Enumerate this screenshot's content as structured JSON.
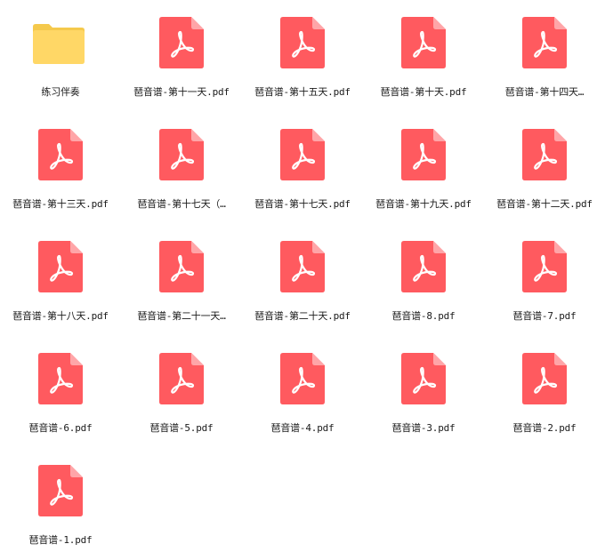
{
  "window": {
    "view": "file-grid"
  },
  "colors": {
    "pdf_red": "#FF5A5F",
    "pdf_fold": "#FFA5A8",
    "folder_yellow": "#FFD766",
    "folder_tab": "#F5C94C",
    "label_text": "#1a1a1a"
  },
  "items": [
    {
      "type": "folder",
      "icon": "folder-icon",
      "label": "练习伴奏"
    },
    {
      "type": "pdf",
      "icon": "pdf-file-icon",
      "label": "琶音谱-第十一天.pdf"
    },
    {
      "type": "pdf",
      "icon": "pdf-file-icon",
      "label": "琶音谱-第十五天.pdf"
    },
    {
      "type": "pdf",
      "icon": "pdf-file-icon",
      "label": "琶音谱-第十天.pdf"
    },
    {
      "type": "pdf",
      "icon": "pdf-file-icon",
      "label": "琶音谱-第十四天…"
    },
    {
      "type": "pdf",
      "icon": "pdf-file-icon",
      "label": "琶音谱-第十三天.pdf"
    },
    {
      "type": "pdf",
      "icon": "pdf-file-icon",
      "label": "琶音谱-第十七天（…"
    },
    {
      "type": "pdf",
      "icon": "pdf-file-icon",
      "label": "琶音谱-第十七天.pdf"
    },
    {
      "type": "pdf",
      "icon": "pdf-file-icon",
      "label": "琶音谱-第十九天.pdf"
    },
    {
      "type": "pdf",
      "icon": "pdf-file-icon",
      "label": "琶音谱-第十二天.pdf"
    },
    {
      "type": "pdf",
      "icon": "pdf-file-icon",
      "label": "琶音谱-第十八天.pdf"
    },
    {
      "type": "pdf",
      "icon": "pdf-file-icon",
      "label": "琶音谱-第二十一天…"
    },
    {
      "type": "pdf",
      "icon": "pdf-file-icon",
      "label": "琶音谱-第二十天.pdf"
    },
    {
      "type": "pdf",
      "icon": "pdf-file-icon",
      "label": "琶音谱-8.pdf"
    },
    {
      "type": "pdf",
      "icon": "pdf-file-icon",
      "label": "琶音谱-7.pdf"
    },
    {
      "type": "pdf",
      "icon": "pdf-file-icon",
      "label": "琶音谱-6.pdf"
    },
    {
      "type": "pdf",
      "icon": "pdf-file-icon",
      "label": "琶音谱-5.pdf"
    },
    {
      "type": "pdf",
      "icon": "pdf-file-icon",
      "label": "琶音谱-4.pdf"
    },
    {
      "type": "pdf",
      "icon": "pdf-file-icon",
      "label": "琶音谱-3.pdf"
    },
    {
      "type": "pdf",
      "icon": "pdf-file-icon",
      "label": "琶音谱-2.pdf"
    },
    {
      "type": "pdf",
      "icon": "pdf-file-icon",
      "label": "琶音谱-1.pdf"
    }
  ]
}
